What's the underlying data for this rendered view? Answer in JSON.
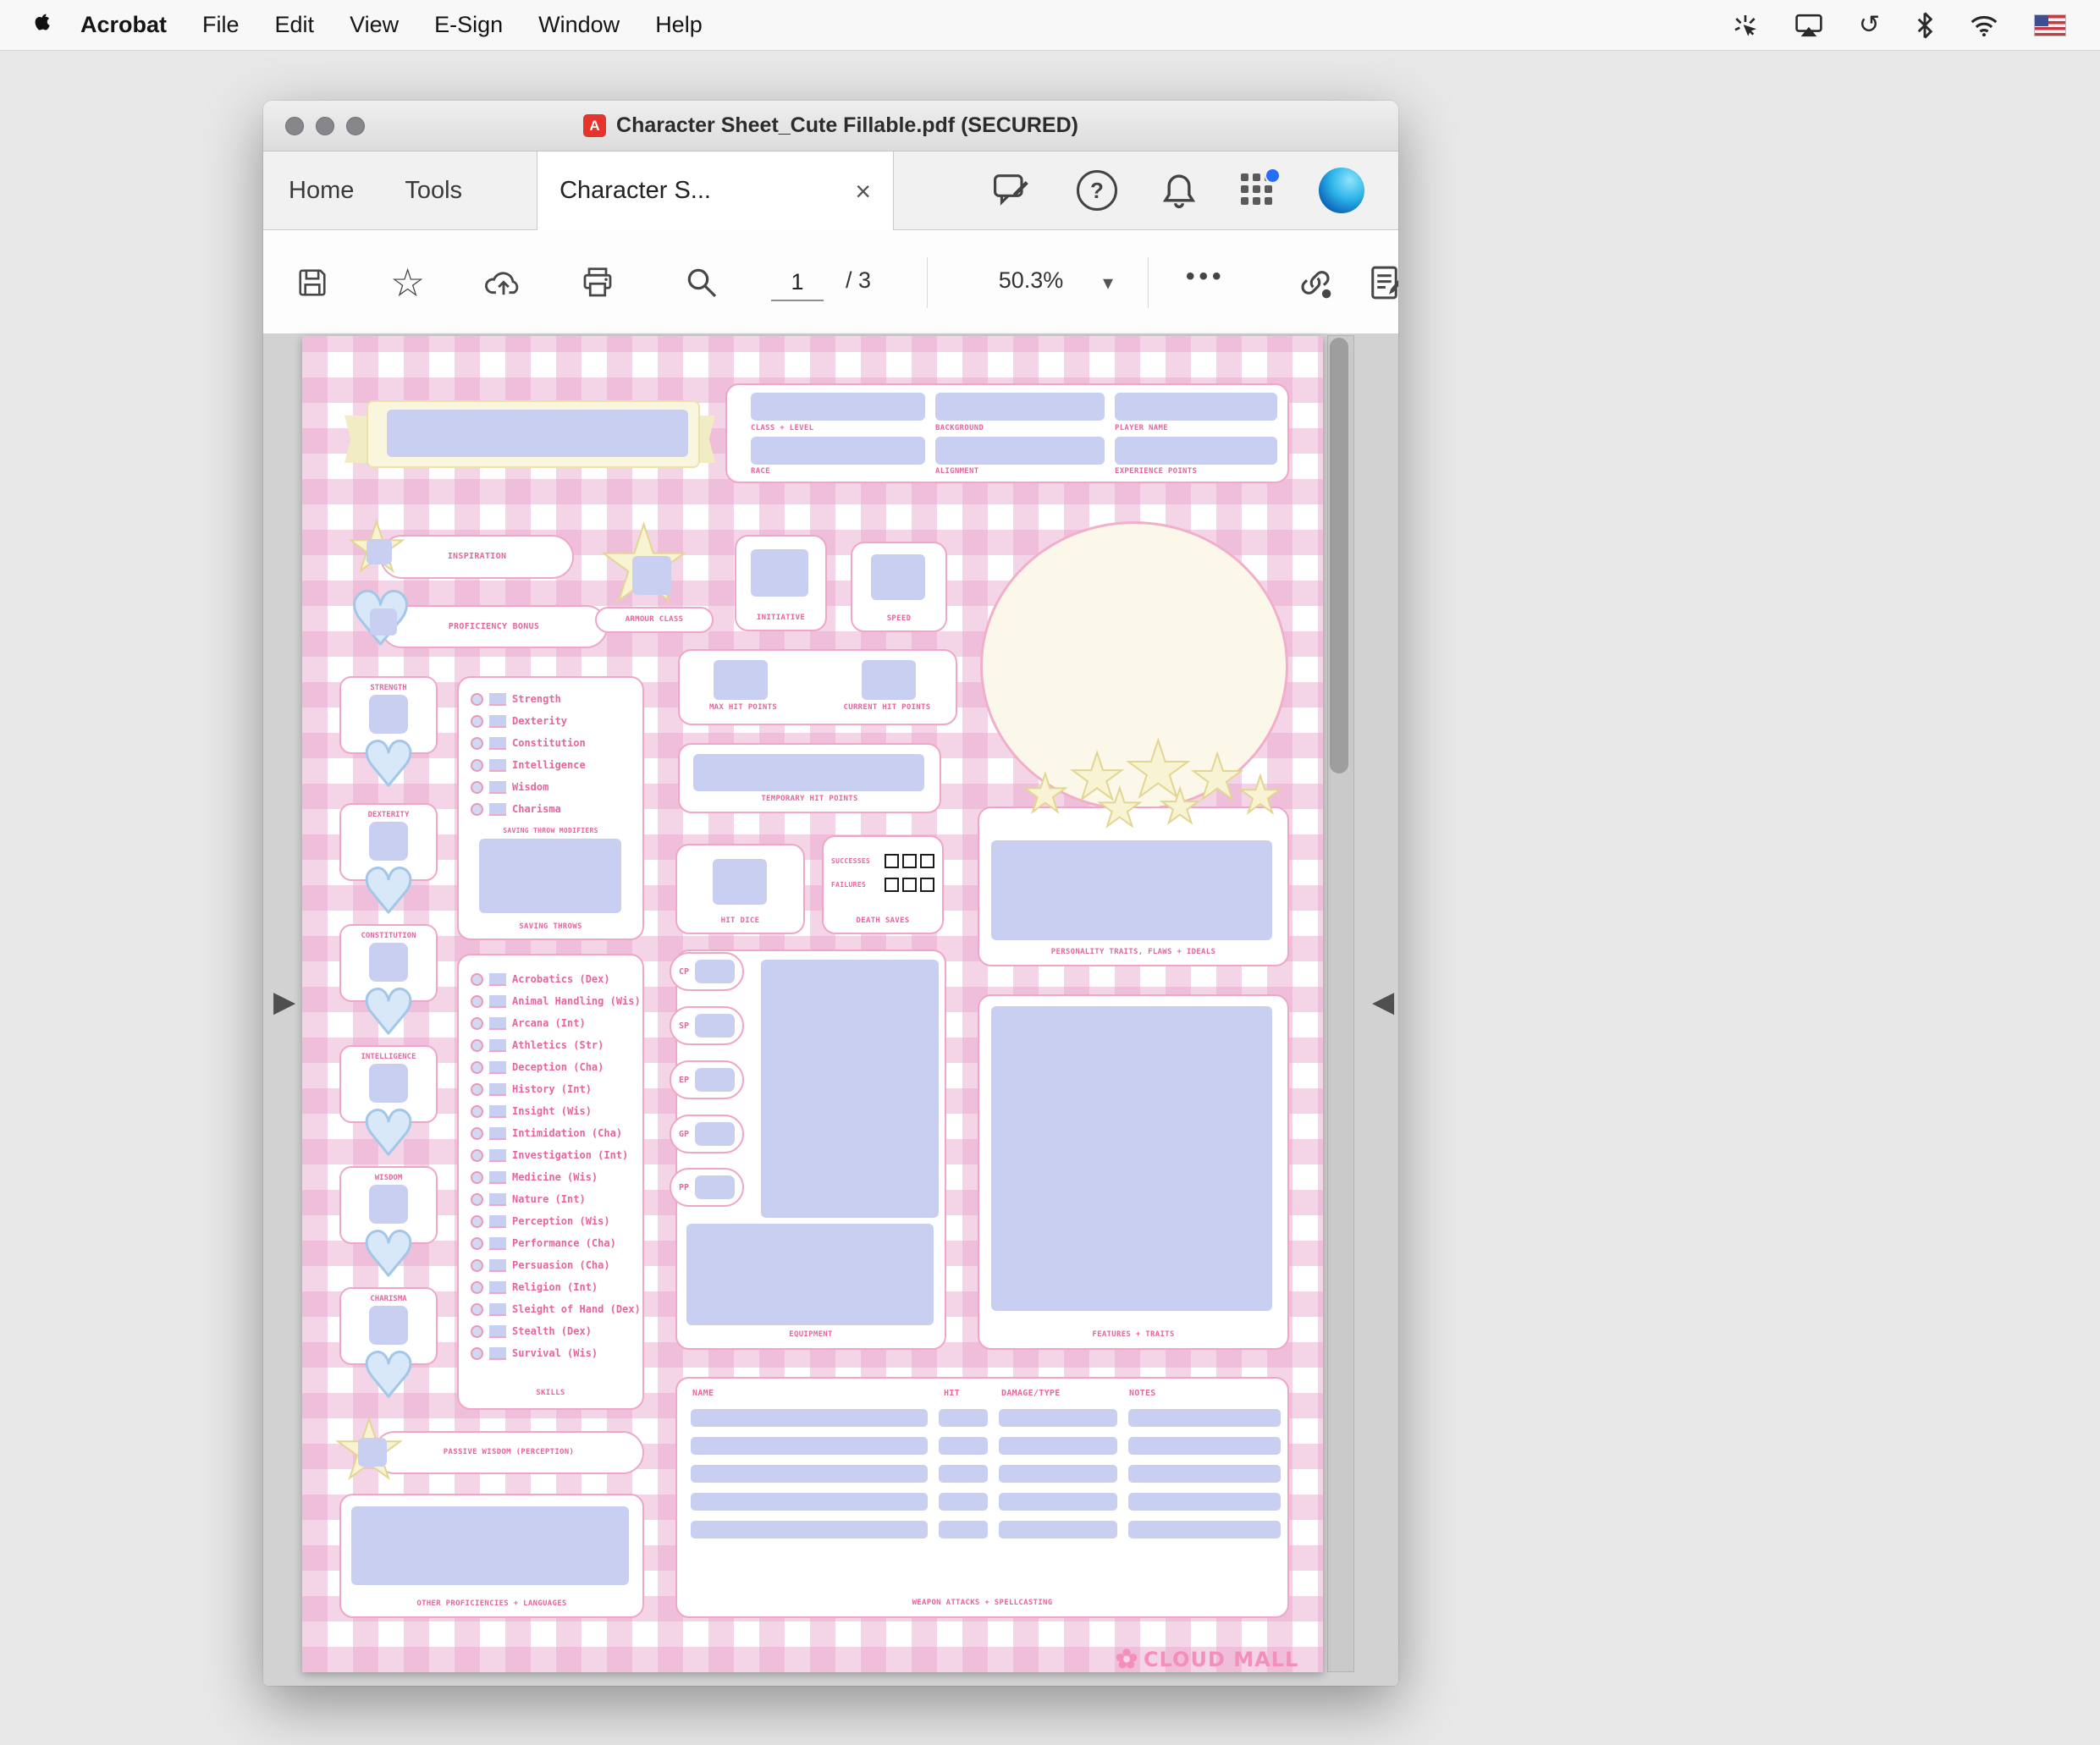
{
  "menu_bar": {
    "items": [
      "Acrobat",
      "File",
      "Edit",
      "View",
      "E-Sign",
      "Window",
      "Help"
    ]
  },
  "window": {
    "title": "Character Sheet_Cute Fillable.pdf  (SECURED)",
    "pdf_icon_letter": "A"
  },
  "tabs": {
    "home": "Home",
    "tools": "Tools",
    "doc_tab": "Character S...",
    "close": "×"
  },
  "toolbar": {
    "page_value": "1",
    "page_count": "/ 3",
    "zoom_value": "50.3%",
    "more_label": "•••"
  },
  "icons": {
    "caret_down": "▾",
    "star_tool": "☆",
    "help": "?",
    "nav_left": "▶",
    "nav_right": "◀",
    "star": "★",
    "heart": "♥"
  },
  "colors": {
    "pink_border": "#f0a6c6",
    "label_pink": "#e5669f",
    "lavender_field": "#c9cff1",
    "cream": "#faf6dd",
    "heart_blue": "#a2c7e9",
    "gingham_pink": "#e7a2cb",
    "brand_pink": "#f48fbb",
    "notification_blue": "#2a6df4"
  },
  "sheet": {
    "header": {
      "class_level": "CLASS + LEVEL",
      "background": "BACKGROUND",
      "player_name": "PLAYER NAME",
      "race": "RACE",
      "alignment": "ALIGNMENT",
      "xp": "EXPERIENCE POINTS"
    },
    "inspiration": "INSPIRATION",
    "proficiency_bonus": "PROFICIENCY BONUS",
    "armour_class": "ARMOUR CLASS",
    "initiative": "INITIATIVE",
    "speed": "SPEED",
    "max_hp": "MAX HIT POINTS",
    "current_hp": "CURRENT HIT POINTS",
    "temp_hp": "TEMPORARY HIT POINTS",
    "abilities": [
      "STRENGTH",
      "DEXTERITY",
      "CONSTITUTION",
      "INTELLIGENCE",
      "WISDOM",
      "CHARISMA"
    ],
    "saving_throws": {
      "rows": [
        "Strength",
        "Dexterity",
        "Constitution",
        "Intelligence",
        "Wisdom",
        "Charisma"
      ],
      "modifiers_label": "SAVING THROW MODIFIERS",
      "label": "SAVING THROWS"
    },
    "hit_dice": "HIT DICE",
    "death_saves": {
      "successes": "SUCCESSES",
      "failures": "FAILURES",
      "label": "DEATH SAVES"
    },
    "personality": "PERSONALITY TRAITS, FLAWS + IDEALS",
    "skills": {
      "rows": [
        "Acrobatics (Dex)",
        "Animal Handling (Wis)",
        "Arcana (Int)",
        "Athletics (Str)",
        "Deception (Cha)",
        "History (Int)",
        "Insight (Wis)",
        "Intimidation (Cha)",
        "Investigation (Int)",
        "Medicine (Wis)",
        "Nature (Int)",
        "Perception (Wis)",
        "Performance (Cha)",
        "Persuasion (Cha)",
        "Religion (Int)",
        "Sleight of Hand (Dex)",
        "Stealth (Dex)",
        "Survival (Wis)"
      ],
      "label": "SKILLS"
    },
    "coins": [
      "CP",
      "SP",
      "EP",
      "GP",
      "PP"
    ],
    "equipment": "EQUIPMENT",
    "features": "FEATURES + TRAITS",
    "passive_wisdom": "PASSIVE WISDOM (PERCEPTION)",
    "other_prof": "OTHER PROFICIENCIES + LANGUAGES",
    "weapons": {
      "headers": [
        "NAME",
        "HIT",
        "DAMAGE/TYPE",
        "NOTES"
      ],
      "label": "WEAPON ATTACKS + SPELLCASTING"
    },
    "brand": "CLOUD MALL"
  }
}
